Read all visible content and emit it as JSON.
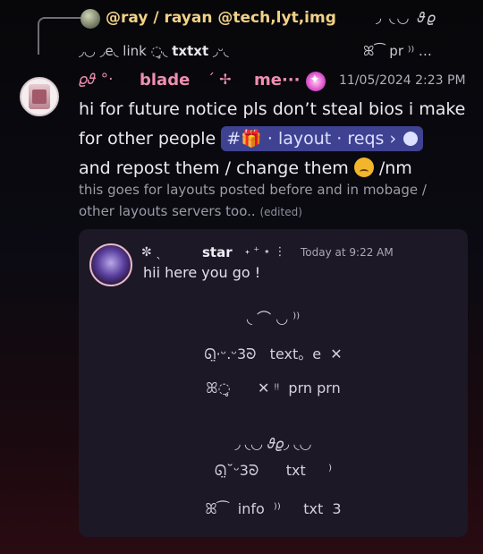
{
  "reply": {
    "author": "@ray / rayan @tech,lyt,img",
    "deco_right": "◞ ◟◡ 𝜗𝜚",
    "preview_left": "◞◡   ◞e◟ ",
    "preview_link": "link ",
    "preview_mid": "◌̥◟ ",
    "preview_bold": "txtxt",
    "preview_tail": " ◞ᵕ◟ ",
    "preview_right": "ꕤ⁀  pr  ⁾⁾  …"
  },
  "message": {
    "deco": "𝜚𝜗 °·",
    "username": "blade",
    "deco2": "ˊ ✢",
    "me": "me···",
    "badge": "✦",
    "timestamp": "11/05/2024 2:23 PM",
    "line1": "hi for future notice pls don’t steal bios i make",
    "line2_start": "for other people ",
    "channel_prefix": "#",
    "channel_gift": "🎁",
    "channel_name": " · layout · reqs ›",
    "line3": "and repost them / change them ",
    "line3_end": " /nm",
    "sub1": "this goes for layouts posted before and in mobage /",
    "sub2": "other layouts servers too.. ",
    "edited": "(edited)"
  },
  "embed": {
    "name_deco": "✼   ˎ",
    "name": "star",
    "name_deco2": "˖ ⁺ ⋆    ⋮",
    "time": "Today at 9:22 AM",
    "text": "hii here you go !",
    "bio_lines": [
      "◟ ⌒ ◡ ⁾⁾",
      "ᘏ̤·ᵕ.ᵕ𝟥ᘐ   text。e  ✕",
      "ꕤ◌̥      ✕ ᵎᵎ  prn prn",
      "◞ ◟◡ 𝜗𝜚◞ ◟◡",
      "ᘏ̤˘ᵕ𝟥ᘐ      txt     ⁾",
      "ꕤ⁀  info  ⁾⁾     txt  𝟥"
    ]
  },
  "colors": {
    "accent_pink": "#ef8fb0",
    "reply_gold": "#f2d186",
    "channel_pill": "#3f4291"
  }
}
